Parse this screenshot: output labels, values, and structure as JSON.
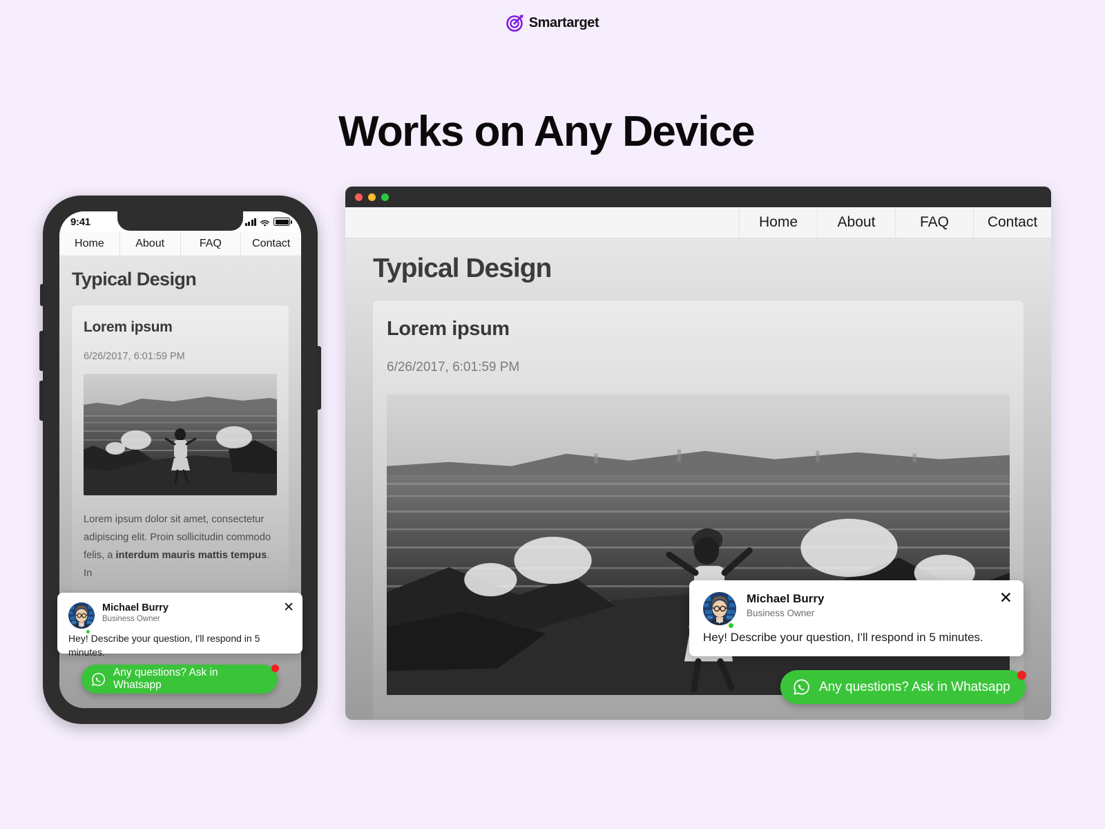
{
  "brand": {
    "name": "Smartarget",
    "logo_icon": "target-dart-icon",
    "accent_color": "#7b1fe0"
  },
  "headline": "Works on Any Device",
  "background_color": "#f6eefd",
  "phone": {
    "device_label": "iphone-mockup",
    "status_bar": {
      "time": "9:41",
      "icons": [
        "signal-bars-icon",
        "wifi-icon",
        "battery-icon"
      ]
    },
    "nav": [
      {
        "label": "Home"
      },
      {
        "label": "About"
      },
      {
        "label": "FAQ"
      },
      {
        "label": "Contact"
      }
    ],
    "page_title": "Typical Design",
    "card": {
      "title": "Lorem ipsum",
      "date": "6/26/2017, 6:01:59 PM",
      "image_alt": "woman running into sea waves black and white photo",
      "body_lead": "Lorem ipsum dolor sit amet, consectetur adipiscing elit. Proin sollicitudin commodo felis, a ",
      "body_bold": "interdum mauris mattis tempus",
      "body_tail": ". In"
    }
  },
  "desktop": {
    "device_label": "browser-window-mockup",
    "traffic_lights": [
      {
        "name": "close",
        "color": "#ff5f57"
      },
      {
        "name": "minimize",
        "color": "#febc2e"
      },
      {
        "name": "maximize",
        "color": "#28c840"
      }
    ],
    "nav": [
      {
        "label": "Home"
      },
      {
        "label": "About"
      },
      {
        "label": "FAQ"
      },
      {
        "label": "Contact"
      }
    ],
    "page_title": "Typical Design",
    "card": {
      "title": "Lorem ipsum",
      "date": "6/26/2017, 6:01:59 PM",
      "image_alt": "woman running into sea waves black and white photo"
    }
  },
  "chat_widget": {
    "agent_name": "Michael Burry",
    "agent_role": "Business Owner",
    "message": "Hey! Describe your question, I'll respond in 5 minutes.",
    "close_label": "✕",
    "avatar_icon": "person-avatar-icon",
    "online_status": "online"
  },
  "whatsapp_button": {
    "label": "Any questions? Ask in Whatsapp",
    "icon": "whatsapp-icon",
    "color": "#3ac43a",
    "badge_color": "#f22020"
  }
}
